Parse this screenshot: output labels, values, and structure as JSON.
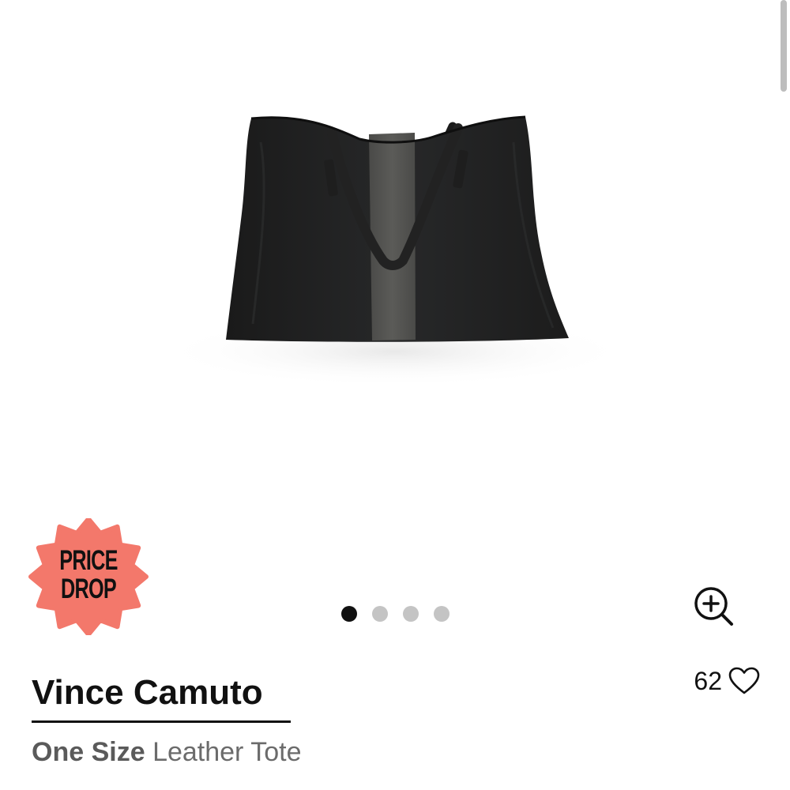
{
  "badge": {
    "line1": "PRICE",
    "line2": "DROP",
    "color": "#f3786b"
  },
  "product": {
    "image_icon": "leather-tote-image",
    "brand": "Vince Camuto",
    "size_label": "One Size",
    "item_name": "Leather Tote"
  },
  "carousel": {
    "total": 4,
    "active_index": 0
  },
  "favorites": {
    "count": "62",
    "icon": "heart-icon"
  },
  "zoom": {
    "icon": "zoom-in-icon"
  }
}
